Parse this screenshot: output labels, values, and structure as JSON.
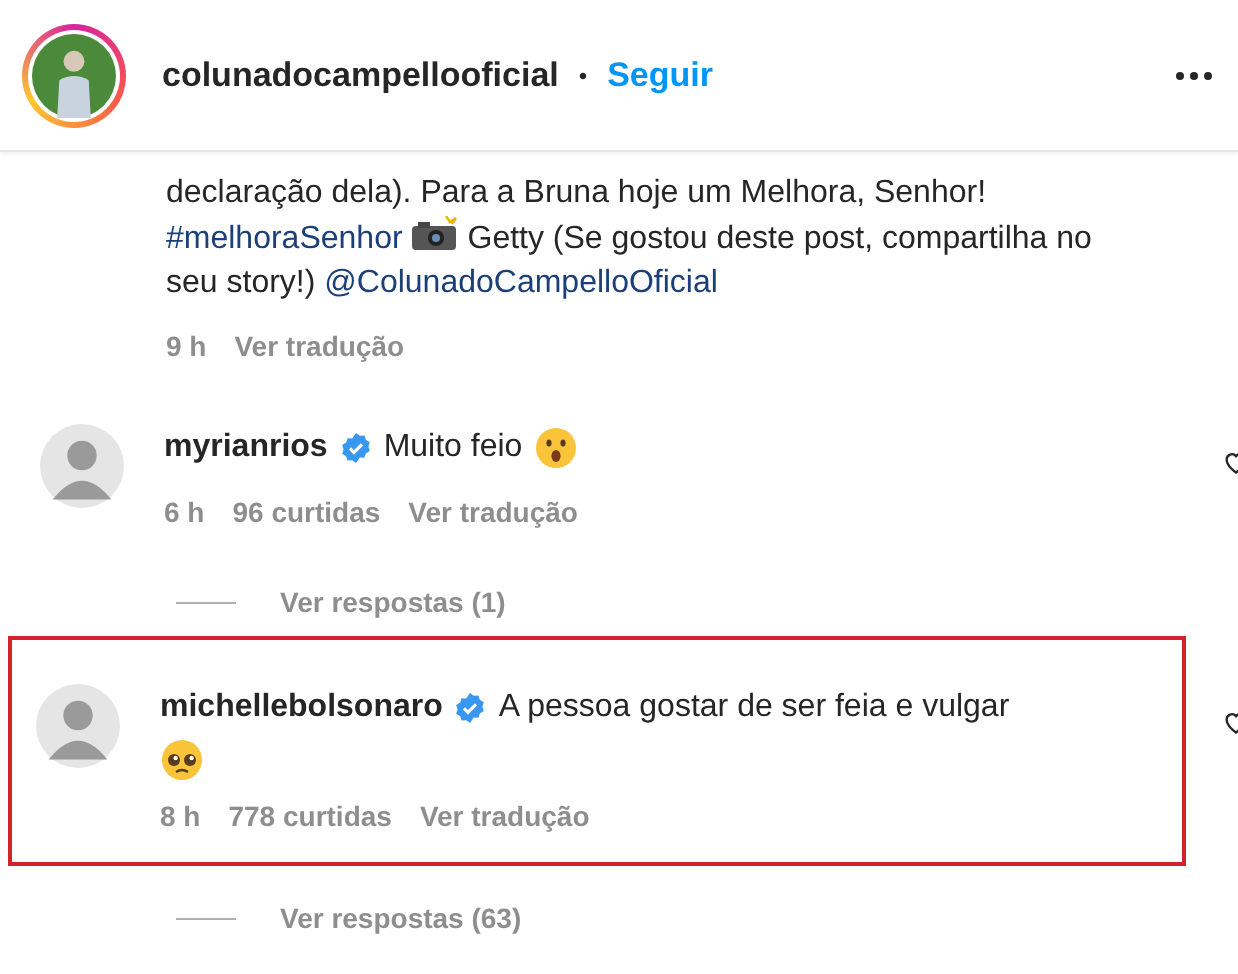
{
  "header": {
    "username": "colunadocampellooficial",
    "separator": "•",
    "follow": "Seguir"
  },
  "caption": {
    "segments": [
      {
        "kind": "text",
        "text": "declaração dela). Para a Bruna hoje um Melhora, Senhor! "
      },
      {
        "kind": "hashtag",
        "text": "#melhoraSenhor"
      },
      {
        "kind": "camera"
      },
      {
        "kind": "text",
        "text": " Getty (Se gostou deste post, compartilha no seu story!) "
      },
      {
        "kind": "mention",
        "text": "@ColunadoCampelloOficial"
      }
    ],
    "time": "9 h",
    "translate": "Ver tradução"
  },
  "comments": [
    {
      "username": "myrianrios",
      "verified": true,
      "text": "Muito feio",
      "emoji": {
        "kind": "astonished"
      },
      "time": "6 h",
      "likes": "96 curtidas",
      "translate": "Ver tradução",
      "replies": "Ver respostas (1)",
      "highlighted": false
    },
    {
      "username": "michellebolsonaro",
      "verified": true,
      "text": "A pessoa gostar de ser feia e vulgar",
      "emoji": {
        "kind": "pleading"
      },
      "time": "8 h",
      "likes": "778 curtidas",
      "translate": "Ver tradução",
      "replies": "Ver respostas (63)",
      "highlighted": true
    }
  ]
}
